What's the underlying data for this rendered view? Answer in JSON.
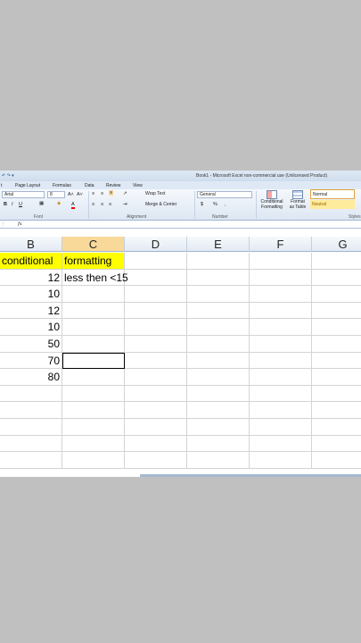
{
  "window": {
    "title": "Book1 - Microsoft Excel non-commercial use (Unlicensed Product)",
    "quick_access": "↶ ↷ ▾"
  },
  "tabs": [
    "t",
    "Page Layout",
    "Formulas",
    "Data",
    "Review",
    "View"
  ],
  "ribbon": {
    "font_name": "Arial",
    "font_size": "8",
    "grow": "A˄",
    "shrink": "A˅",
    "bold": "B",
    "italic": "I",
    "underline": "U",
    "font_color": "A",
    "wrap_text": "Wrap Text",
    "merge_center": "Merge & Center",
    "number_format": "General",
    "currency": "$",
    "percent": "%",
    "comma": ",",
    "cond_format_line1": "Conditional",
    "cond_format_line2": "Formatting",
    "format_table_line1": "Format",
    "format_table_line2": "as Table",
    "style_normal": "Normal",
    "style_neutral": "Neutral",
    "group_font": "Font",
    "group_alignment": "Alignment",
    "group_number": "Number",
    "group_styles": "Styles"
  },
  "formula_bar": {
    "fx": "fx",
    "content": ""
  },
  "columns": [
    "B",
    "C",
    "D",
    "E",
    "F",
    "G"
  ],
  "rows": [
    {
      "b": "conditional",
      "c": "formatting",
      "c_highlight": true
    },
    {
      "b": "12",
      "c": "less then <15"
    },
    {
      "b": "10",
      "c": ""
    },
    {
      "b": "12",
      "c": ""
    },
    {
      "b": "10",
      "c": ""
    },
    {
      "b": "50",
      "c": ""
    },
    {
      "b": "70",
      "c": ""
    },
    {
      "b": "80",
      "c": ""
    },
    {
      "b": "",
      "c": ""
    },
    {
      "b": "",
      "c": ""
    },
    {
      "b": "",
      "c": ""
    },
    {
      "b": "",
      "c": ""
    },
    {
      "b": "",
      "c": ""
    }
  ],
  "colors": {
    "highlight": "#ffff00",
    "selected_header": "#f9d99a"
  }
}
